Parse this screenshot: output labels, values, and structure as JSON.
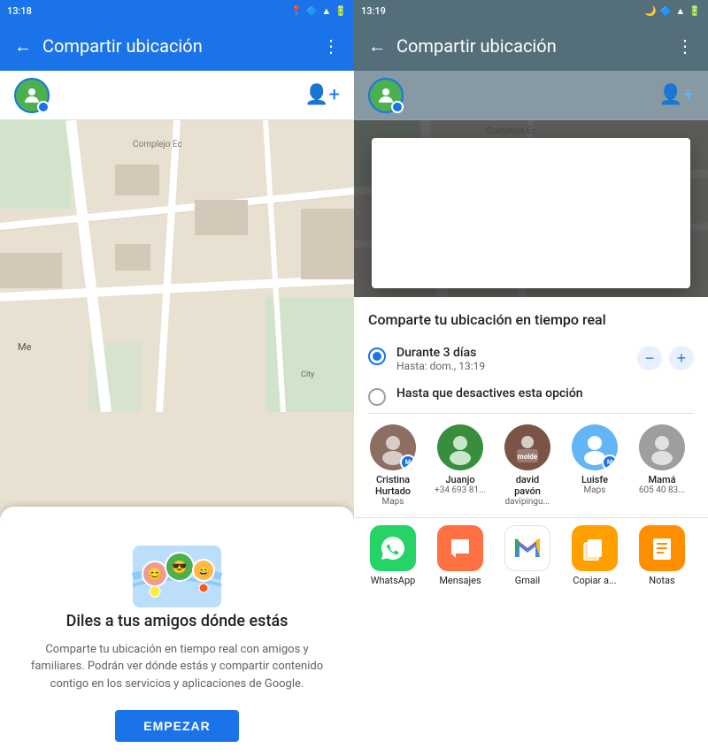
{
  "left": {
    "statusBar": {
      "time": "13:18",
      "icons": [
        "location-icon",
        "maps-icon",
        "battery-icon"
      ]
    },
    "header": {
      "back": "←",
      "title": "Compartir ubicación",
      "menu": "⋮"
    },
    "promo": {
      "title": "Diles a tus amigos dónde estás",
      "description": "Comparte tu ubicación en tiempo real con amigos y familiares. Podrán ver dónde estás y compartir contenido contigo en los servicios y aplicaciones de Google.",
      "buttonLabel": "EMPEZAR"
    }
  },
  "right": {
    "statusBar": {
      "time": "13:19"
    },
    "header": {
      "back": "←",
      "title": "Compartir ubicación",
      "menu": "⋮"
    },
    "shareTitle": "Comparte tu ubicación en tiempo real",
    "options": [
      {
        "label": "Durante 3 días",
        "sublabel": "Hasta: dom., 13:19",
        "selected": true
      },
      {
        "label": "Hasta que desactives esta opción",
        "sublabel": "",
        "selected": false
      }
    ],
    "contacts": [
      {
        "name": "Cristina",
        "name2": "Hurtado",
        "sub": "Maps",
        "color": "#8d6e63",
        "hasBadge": true
      },
      {
        "name": "Juanjo",
        "name2": "",
        "sub": "+34 693 81...",
        "color": "#388e3c",
        "hasBadge": false
      },
      {
        "name": "david",
        "name2": "pavón",
        "sub": "davipingu...",
        "color": "#795548",
        "hasBadge": false
      },
      {
        "name": "Luisfe",
        "name2": "",
        "sub": "Maps",
        "color": "#64b5f6",
        "hasBadge": true
      },
      {
        "name": "Mamá",
        "name2": "",
        "sub": "605 40 83...",
        "color": "#9e9e9e",
        "hasBadge": false
      }
    ],
    "apps": [
      {
        "name": "WhatsApp",
        "color": "#25D366",
        "icon": "💬"
      },
      {
        "name": "Mensajes",
        "color": "#FF7043",
        "icon": "✉"
      },
      {
        "name": "Gmail",
        "color": "#fff",
        "icon": "M",
        "border": "#e0e0e0"
      },
      {
        "name": "Copiar a...",
        "color": "#FFA000",
        "icon": "📋"
      },
      {
        "name": "Notas",
        "color": "#FF8F00",
        "icon": "📝"
      }
    ]
  }
}
